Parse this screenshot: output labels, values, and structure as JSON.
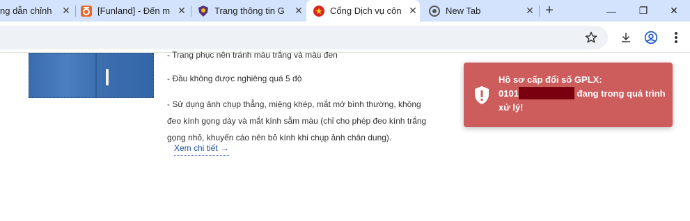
{
  "tabs": [
    {
      "title": "ng dẫn chỉnh",
      "icon": "page-icon",
      "active": false
    },
    {
      "title": "[Funland] - Đến m",
      "icon": "funland-logo-icon",
      "active": false
    },
    {
      "title": "Trang thông tin G",
      "icon": "police-emblem-icon",
      "active": false
    },
    {
      "title": "Cổng Dịch vụ côn",
      "icon": "vn-emblem-icon",
      "active": true
    },
    {
      "title": "New Tab",
      "icon": "chrome-icon",
      "active": false
    }
  ],
  "window_controls": {
    "minimize": "—",
    "restore": "❐",
    "close": "✕"
  },
  "new_tab_label": "+",
  "content": {
    "guide_1": "- Trang phục nên tránh màu trắng và màu đen",
    "guide_2": "- Đầu không được nghiêng quá 5 độ",
    "guide_3": "- Sử dụng ảnh chụp thẳng, miệng khép, mắt mở bình thường, không đeo kính gọng dày và mắt kính sẫm màu (chỉ cho phép đeo kính trắng gọng nhỏ, khuyến cáo nên bỏ kính khi chụp ảnh chân dung).",
    "more_link": "Xem chi tiết",
    "more_arrow": "→"
  },
  "toast": {
    "line1": "Hồ sơ cấp đổi số GPLX:",
    "prefix": "0101",
    "suffix": " đang trong quá trình xử lý!",
    "color": "#cd5c5c"
  },
  "colors": {
    "tabstrip": "#d3e3fd",
    "link": "#1a4e9c"
  }
}
